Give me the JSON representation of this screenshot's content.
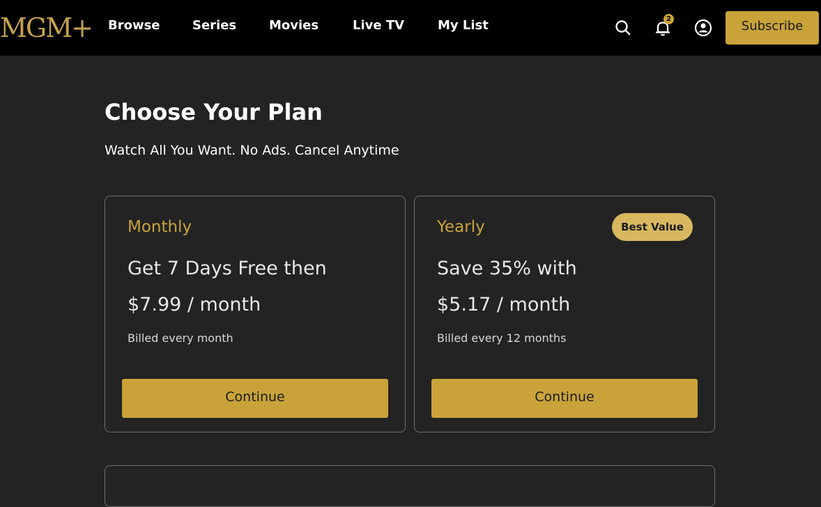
{
  "header": {
    "logo": "MGM+",
    "nav": [
      "Browse",
      "Series",
      "Movies",
      "Live TV",
      "My List"
    ],
    "search_icon": "search-icon",
    "notifications_icon": "bell-icon",
    "notification_count": "2",
    "account_icon": "user-circle-icon",
    "subscribe_label": "Subscribe"
  },
  "main": {
    "title": "Choose Your Plan",
    "subtitle": "Watch All You Want. No Ads. Cancel Anytime",
    "plans": [
      {
        "name": "Monthly",
        "headline": "Get 7 Days Free then",
        "price": "$7.99 / month",
        "billing": "Billed every month",
        "button": "Continue"
      },
      {
        "name": "Yearly",
        "badge": "Best Value",
        "headline": "Save 35% with",
        "price": "$5.17 / month",
        "billing": "Billed every 12 months",
        "button": "Continue"
      }
    ]
  },
  "colors": {
    "header_bg": "#000000",
    "page_bg": "#232323",
    "accent_gold": "#c9a33a",
    "badge_gold": "#d8b75f",
    "card_border": "#6e6e6e"
  }
}
